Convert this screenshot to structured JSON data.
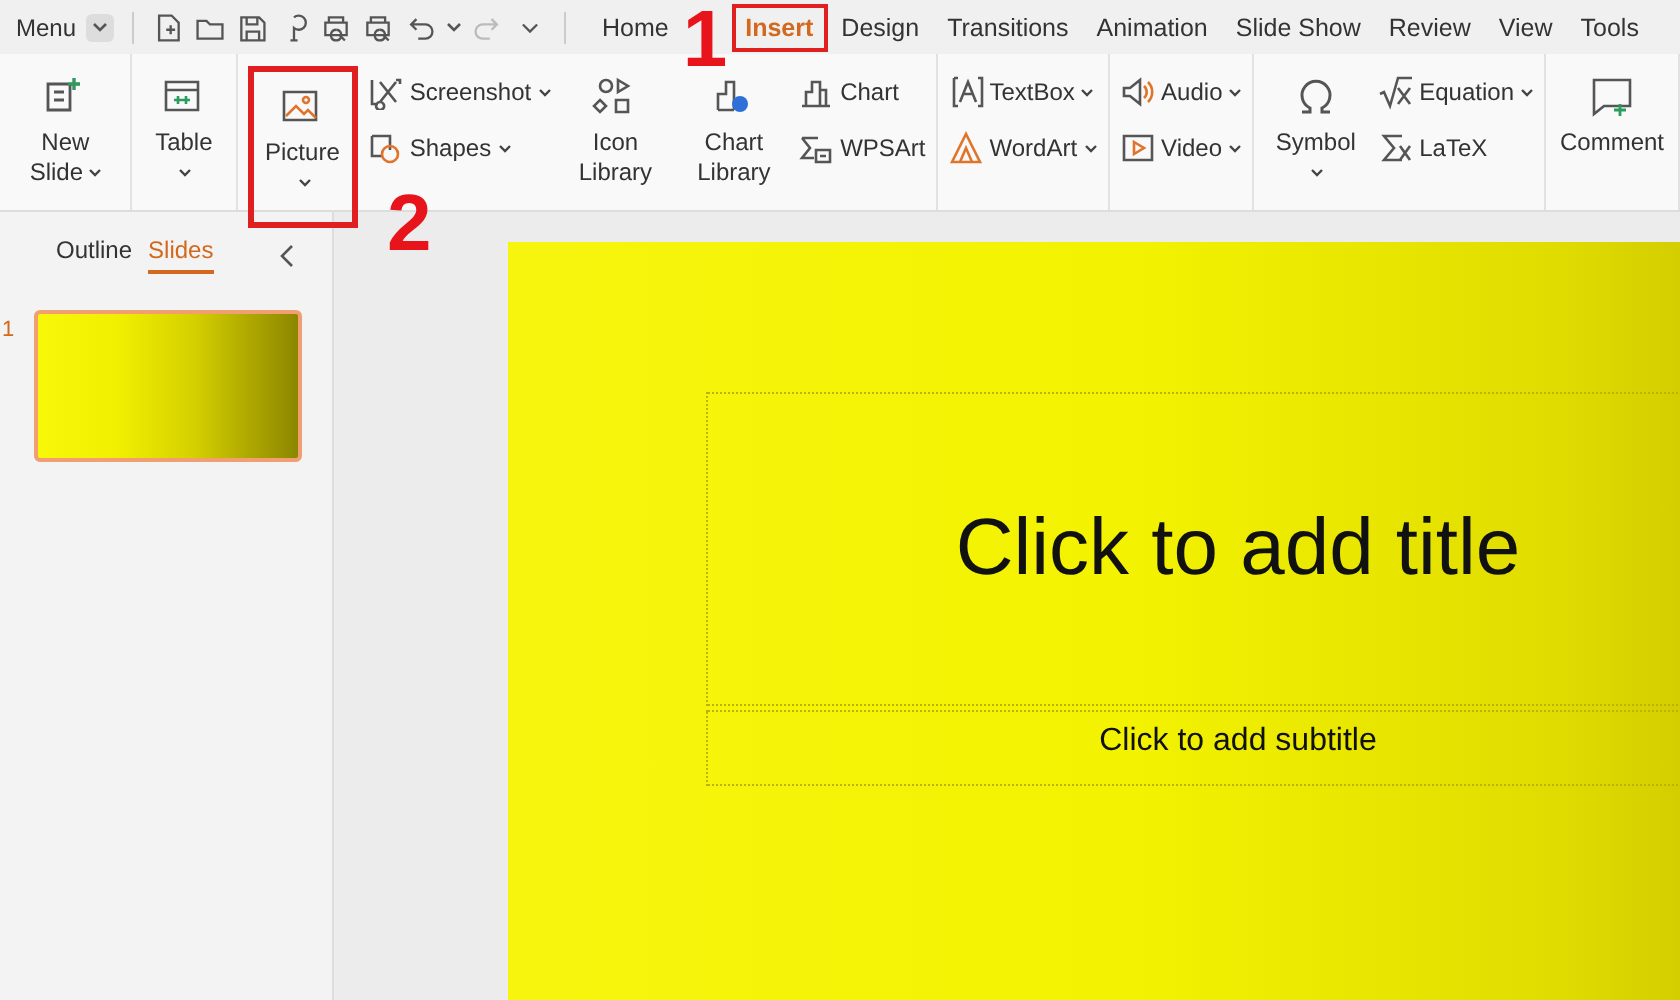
{
  "quick_access": {
    "menu": "Menu"
  },
  "tabs": [
    {
      "label": "Home",
      "selected": false,
      "highlighted": false
    },
    {
      "label": "Insert",
      "selected": true,
      "highlighted": true,
      "callout": "1"
    },
    {
      "label": "Design",
      "selected": false,
      "highlighted": false
    },
    {
      "label": "Transitions",
      "selected": false,
      "highlighted": false
    },
    {
      "label": "Animation",
      "selected": false,
      "highlighted": false
    },
    {
      "label": "Slide Show",
      "selected": false,
      "highlighted": false
    },
    {
      "label": "Review",
      "selected": false,
      "highlighted": false
    },
    {
      "label": "View",
      "selected": false,
      "highlighted": false
    },
    {
      "label": "Tools",
      "selected": false,
      "highlighted": false
    }
  ],
  "ribbon": [
    {
      "items": [
        {
          "kind": "large",
          "label": "New Slide",
          "dropdown": true
        }
      ]
    },
    {
      "items": [
        {
          "kind": "large",
          "label": "Table",
          "dropdown": true
        }
      ]
    },
    {
      "items": [
        {
          "kind": "large",
          "label": "Picture",
          "dropdown": true,
          "highlighted": true,
          "callout": "2"
        },
        {
          "kind": "small",
          "label": "Screenshot",
          "dropdown": true
        },
        {
          "kind": "small",
          "label": "Shapes",
          "dropdown": true
        },
        {
          "kind": "large",
          "label": "Icon Library",
          "dropdown": false
        },
        {
          "kind": "large",
          "label": "Chart Library",
          "dropdown": false
        },
        {
          "kind": "small",
          "label": "Chart",
          "dropdown": false
        },
        {
          "kind": "small",
          "label": "WPSArt",
          "dropdown": false
        }
      ]
    },
    {
      "items": [
        {
          "kind": "small",
          "label": "TextBox",
          "dropdown": true
        },
        {
          "kind": "small",
          "label": "WordArt",
          "dropdown": true
        }
      ]
    },
    {
      "items": [
        {
          "kind": "small",
          "label": "Audio",
          "dropdown": true
        },
        {
          "kind": "small",
          "label": "Video",
          "dropdown": true
        }
      ]
    },
    {
      "items": [
        {
          "kind": "large",
          "label": "Symbol",
          "dropdown": true
        },
        {
          "kind": "small",
          "label": "Equation",
          "dropdown": true
        },
        {
          "kind": "small",
          "label": "LaTeX",
          "dropdown": false
        }
      ]
    },
    {
      "items": [
        {
          "kind": "large",
          "label": "Comment",
          "dropdown": false
        }
      ]
    }
  ],
  "sidebar": {
    "tabs": [
      {
        "label": "Outline",
        "selected": false
      },
      {
        "label": "Slides",
        "selected": true
      }
    ],
    "slides": [
      {
        "number": "1",
        "selected": true
      }
    ]
  },
  "slide": {
    "title_placeholder": "Click to add title",
    "subtitle_placeholder": "Click to add subtitle"
  }
}
